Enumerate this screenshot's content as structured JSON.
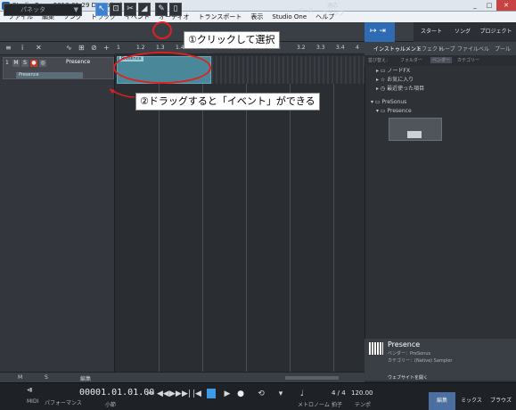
{
  "window": {
    "title": "Studio One - 2016-01-29 Demo(Kz)",
    "min": "_",
    "max": "□",
    "close": "✕"
  },
  "menu": [
    "ファイル",
    "編集",
    "ソング",
    "トラック",
    "イベント",
    "オーディオ",
    "トランスポート",
    "表示",
    "Studio One",
    "ヘルプ"
  ],
  "toolbar": {
    "preset": "パネッタ",
    "timebase_label": "ベース",
    "snap_label_top": "適応",
    "snap_label": "スナップ",
    "start_label": "スタート",
    "song_label": "ソング",
    "project_label": "プロジェクト"
  },
  "track": {
    "number": "1",
    "name": "Presence",
    "instrument": "Presence",
    "mute": "M",
    "solo": "S",
    "rec": "●",
    "mon": "◎"
  },
  "ruler": [
    "1",
    "1.2",
    "1.3",
    "1.4",
    "2",
    "2.2",
    "2.3",
    "2.4",
    "3",
    "3.2",
    "3.3",
    "3.4",
    "4"
  ],
  "event": {
    "label": "Presence"
  },
  "bottom": {
    "m": "M",
    "s": "S",
    "mode": "編集"
  },
  "browser": {
    "tabs": [
      "インストゥルメント",
      "エフェクト",
      "ループ",
      "ファイル",
      "ベル",
      "プール"
    ],
    "sort_labels": [
      "並び替え：",
      "フォルダー",
      "ベンダー",
      "カテゴリー"
    ],
    "tree": [
      {
        "label": "ノードFX",
        "icon": "folder-icon"
      },
      {
        "label": "お気に入り",
        "icon": "star-icon"
      },
      {
        "label": "最近使った項目",
        "icon": "clock-icon"
      },
      {
        "label": "PreSonus",
        "icon": "folder-icon"
      },
      {
        "label": "Presence",
        "icon": "folder-icon"
      }
    ],
    "info": {
      "title": "Presence",
      "vendor": "ベンダー：PreSonus",
      "category": "カテゴリー：(Native)  Sampler",
      "website": "ウェブサイトを開く"
    }
  },
  "transport": {
    "timecode": "00001.01.01.00",
    "timecode_unit": "小節",
    "midi_label": "MIDI",
    "perf_label": "パフォーマンス",
    "meter": "4 / 4",
    "meter_label": "拍子",
    "tempo": "120.00",
    "tempo_label": "テンポ",
    "metronome_label": "メトロノーム",
    "tabs": [
      "編集",
      "ミックス",
      "ブラウズ"
    ]
  },
  "annotations": {
    "step1": "①クリックして選択",
    "step2": "②ドラッグすると「イベント」ができる",
    "color": "#e02020"
  }
}
